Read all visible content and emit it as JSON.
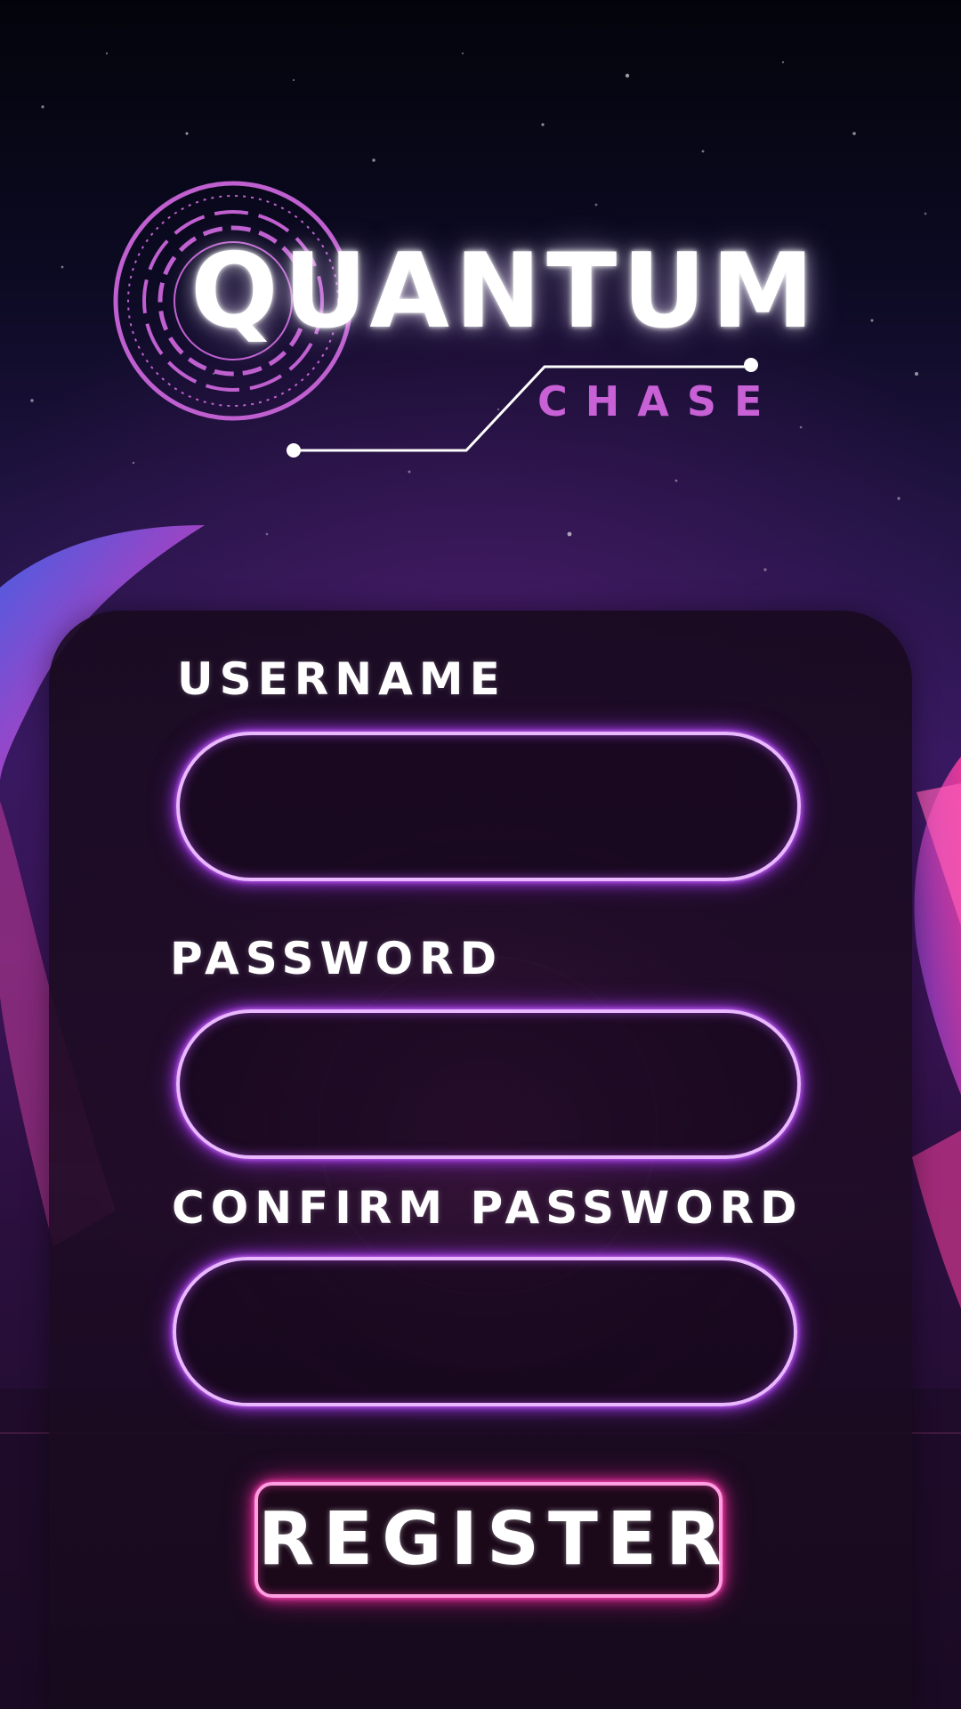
{
  "app": {
    "title": "QUANTUM",
    "subtitle": "CHASE"
  },
  "form": {
    "username": {
      "label": "USERNAME",
      "value": "",
      "placeholder": ""
    },
    "password": {
      "label": "PASSWORD",
      "value": "",
      "placeholder": ""
    },
    "confirm_password": {
      "label": "CONFIRM PASSWORD",
      "value": "",
      "placeholder": ""
    },
    "register_label": "REGISTER"
  },
  "colors": {
    "field_glow": "#b23cff",
    "field_border": "#e9b8ff",
    "button_glow": "#ff2ea8",
    "logo_accent": "#c860d6",
    "title_text": "#ffffff"
  },
  "icons": {
    "logo_emblem": "concentric-circles-icon"
  }
}
